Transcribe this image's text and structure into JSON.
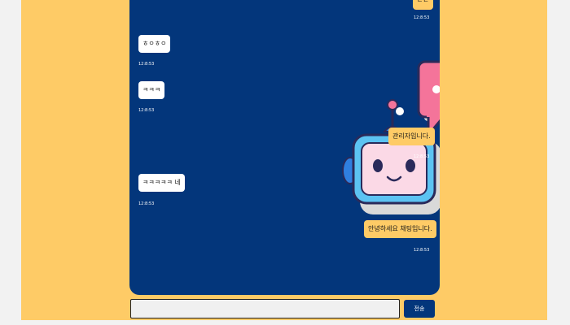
{
  "colors": {
    "page_background": "#fecb66",
    "chat_background": "#03367b",
    "my_bubble": "#fecb66",
    "other_bubble": "#ffffff",
    "send_button": "#03367b"
  },
  "messages": [
    {
      "side": "mine",
      "text": "ㄷㄷ",
      "time": "12:8:53"
    },
    {
      "side": "other",
      "text": "ㅎㅇㅎㅇ",
      "time": "12:8:53"
    },
    {
      "side": "other",
      "text": "ㅋㅋㅋ",
      "time": "12:8:53"
    },
    {
      "side": "mine",
      "text": "관리자입니다.",
      "time": "12:8:53"
    },
    {
      "side": "other",
      "text": "ㅋㅋㅋㅋㅋ 네",
      "time": "12:8:53"
    },
    {
      "side": "mine",
      "text": "안녕하세요 채팅입니다.",
      "time": "12:8:53"
    }
  ],
  "illustration": "chatbot-robot-with-speech-bubble",
  "composer": {
    "input_value": "",
    "send_label": "전송"
  }
}
